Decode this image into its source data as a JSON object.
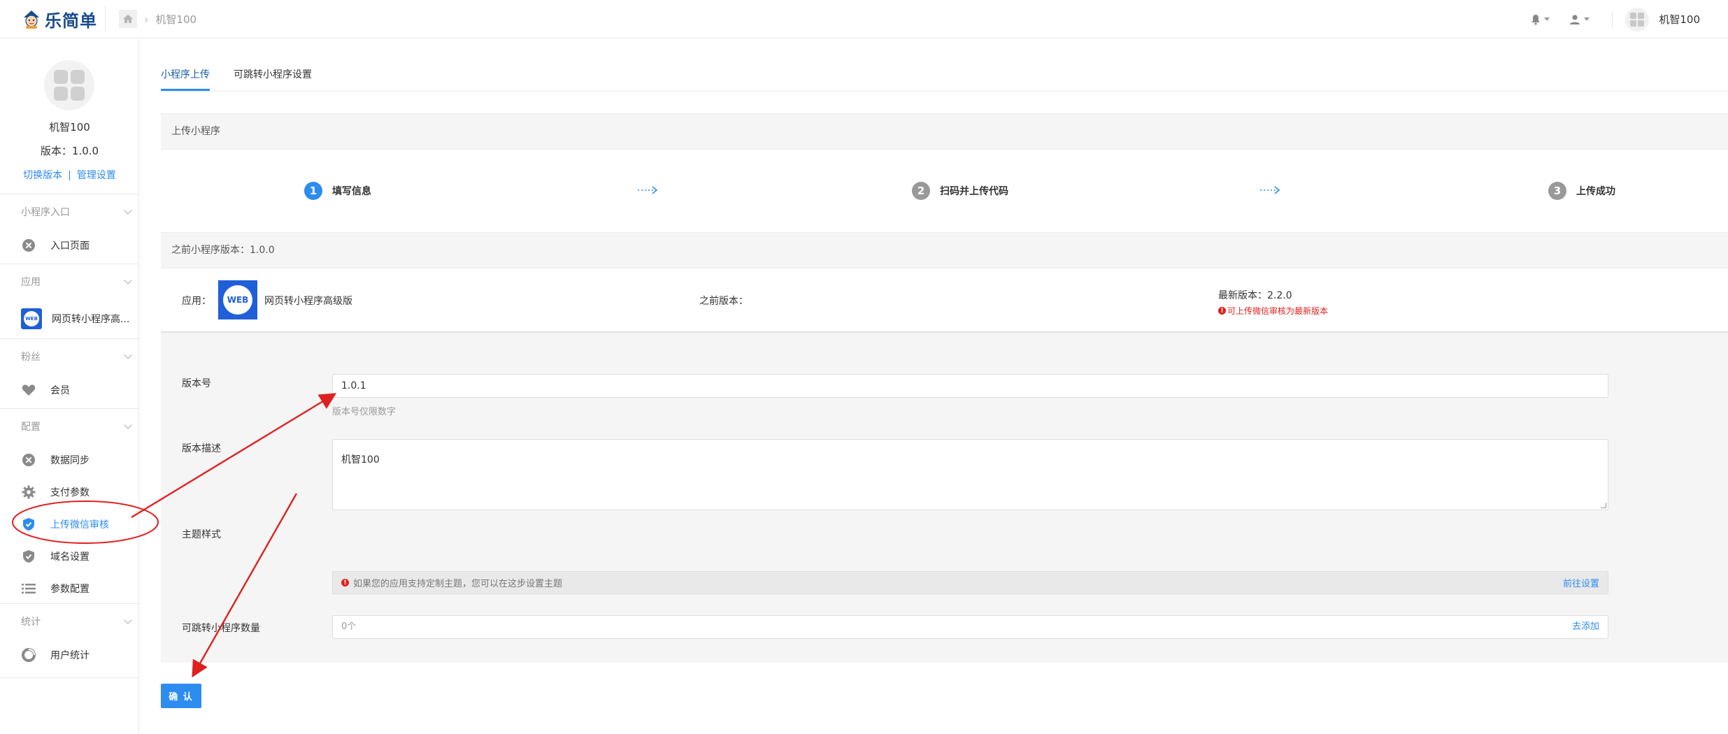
{
  "header": {
    "logo_text": "乐简单",
    "breadcrumb_current": "机智100",
    "user_name": "机智100"
  },
  "sidebar": {
    "app_name": "机智100",
    "version": "版本：1.0.0",
    "switch_version": "切换版本",
    "link_separator": "|",
    "manage_settings": "管理设置",
    "sections": [
      {
        "title": "小程序入口",
        "items": [
          {
            "label": "入口页面",
            "icon": "link-icon"
          }
        ]
      },
      {
        "title": "应用",
        "items": [
          {
            "label": "网页转小程序高...",
            "icon": "web-app-icon"
          }
        ]
      },
      {
        "title": "粉丝",
        "items": [
          {
            "label": "会员",
            "icon": "heart-icon"
          }
        ]
      },
      {
        "title": "配置",
        "items": [
          {
            "label": "数据同步",
            "icon": "link-icon"
          },
          {
            "label": "支付参数",
            "icon": "gear-icon"
          },
          {
            "label": "上传微信审核",
            "icon": "shield-icon",
            "active": true
          },
          {
            "label": "域名设置",
            "icon": "shield-icon"
          },
          {
            "label": "参数配置",
            "icon": "list-icon"
          }
        ]
      },
      {
        "title": "统计",
        "items": [
          {
            "label": "用户统计",
            "icon": "pie-chart-icon"
          }
        ]
      }
    ]
  },
  "tabs": [
    {
      "label": "小程序上传",
      "active": true
    },
    {
      "label": "可跳转小程序设置",
      "active": false
    }
  ],
  "upload": {
    "panel_title": "上传小程序",
    "steps": [
      {
        "num": "1",
        "label": "填写信息",
        "color": "#2d8cf0"
      },
      {
        "num": "2",
        "label": "扫码并上传代码",
        "color": "#999999"
      },
      {
        "num": "3",
        "label": "上传成功",
        "color": "#999999"
      }
    ],
    "prev_version_title": "之前小程序版本：1.0.0",
    "app_label": "应用：",
    "app_logo_text": "WEB",
    "app_name": "网页转小程序高级版",
    "prev_version_label": "之前版本：",
    "latest_version": "最新版本：2.2.0",
    "latest_note": "可上传微信审核为最新版本",
    "warning_mark": "!"
  },
  "form": {
    "version_label": "版本号",
    "version_value": "1.0.1",
    "version_hint": "版本号仅限数字",
    "desc_label": "版本描述",
    "desc_value": "机智100",
    "theme_label": "主题样式",
    "theme_notice": "如果您的应用支持定制主题，您可以在这步设置主题",
    "theme_link": "前往设置",
    "jump_label": "可跳转小程序数量",
    "jump_value": "0个",
    "jump_link": "去添加"
  },
  "confirm_label": "确 认",
  "colors": {
    "accent": "#2d8cf0",
    "annotation": "#e0201f",
    "error": "#e0201f"
  }
}
